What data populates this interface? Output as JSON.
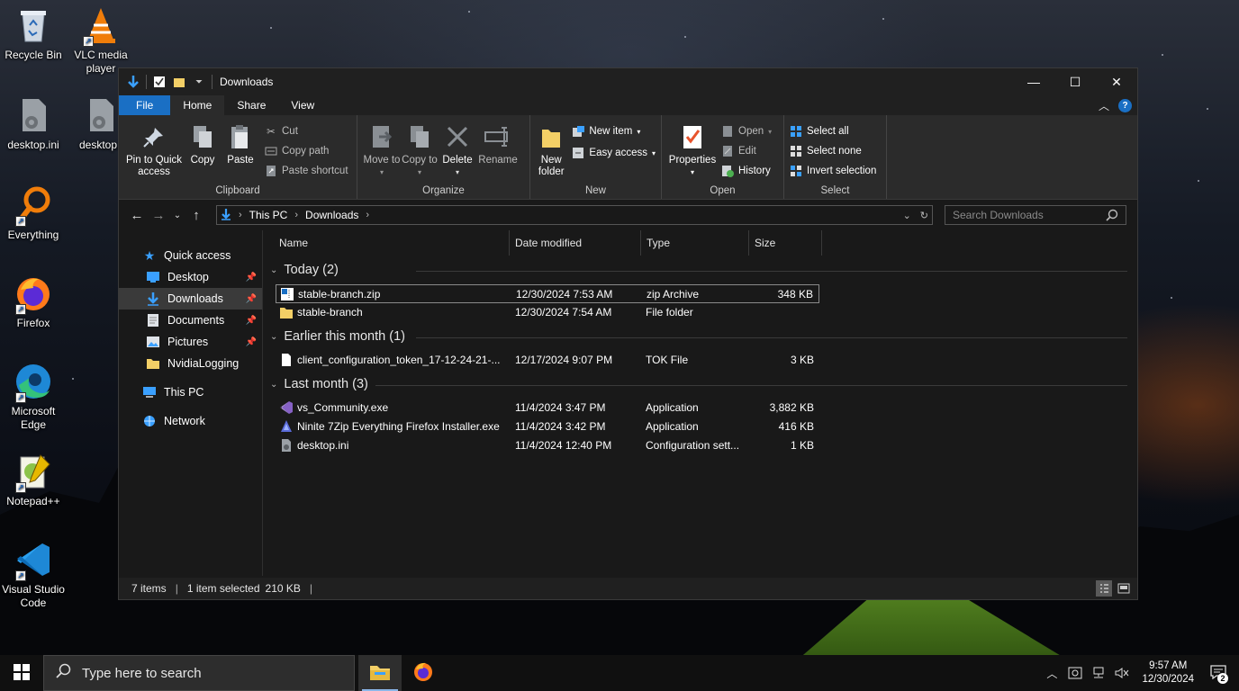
{
  "desktop": {
    "icons": [
      {
        "label": "Recycle Bin",
        "icon": "recycle-bin-icon"
      },
      {
        "label": "VLC media player",
        "icon": "vlc-icon"
      },
      {
        "label": "desktop.ini",
        "icon": "settings-file-icon"
      },
      {
        "label": "desktop.i",
        "icon": "settings-file-icon"
      },
      {
        "label": "Everything",
        "icon": "everything-search-icon"
      },
      {
        "label": "Firefox",
        "icon": "firefox-icon"
      },
      {
        "label": "Microsoft Edge",
        "icon": "edge-icon"
      },
      {
        "label": "Notepad++",
        "icon": "notepadpp-icon"
      },
      {
        "label": "Visual Studio Code",
        "icon": "vscode-icon"
      }
    ]
  },
  "window": {
    "title": "Downloads",
    "controls": {
      "minimize": "—",
      "maximize": "☐",
      "close": "✕"
    }
  },
  "ribbon_tabs": [
    "File",
    "Home",
    "Share",
    "View"
  ],
  "ribbon": {
    "clipboard": {
      "label": "Clipboard",
      "pin": "Pin to Quick access",
      "copy": "Copy",
      "paste": "Paste",
      "cut": "Cut",
      "copy_path": "Copy path",
      "paste_shortcut": "Paste shortcut"
    },
    "organize": {
      "label": "Organize",
      "move_to": "Move to",
      "copy_to": "Copy to",
      "delete": "Delete",
      "rename": "Rename"
    },
    "new": {
      "label": "New",
      "new_folder": "New folder",
      "new_item": "New item",
      "easy_access": "Easy access"
    },
    "open": {
      "label": "Open",
      "properties": "Properties",
      "open": "Open",
      "edit": "Edit",
      "history": "History"
    },
    "select": {
      "label": "Select",
      "select_all": "Select all",
      "select_none": "Select none",
      "invert": "Invert selection"
    }
  },
  "address": {
    "crumbs": [
      "This PC",
      "Downloads"
    ],
    "search_placeholder": "Search Downloads"
  },
  "nav": {
    "quick_access": "Quick access",
    "items": [
      {
        "label": "Desktop",
        "pinned": true
      },
      {
        "label": "Downloads",
        "pinned": true
      },
      {
        "label": "Documents",
        "pinned": true
      },
      {
        "label": "Pictures",
        "pinned": true
      },
      {
        "label": "NvidiaLogging",
        "pinned": false
      }
    ],
    "this_pc": "This PC",
    "network": "Network"
  },
  "columns": [
    "Name",
    "Date modified",
    "Type",
    "Size"
  ],
  "groups": [
    {
      "title": "Today (2)",
      "files": [
        {
          "name": "stable-branch.zip",
          "date": "12/30/2024 7:53 AM",
          "type": "zip Archive",
          "size": "348 KB",
          "icon": "zip-icon",
          "selected": true
        },
        {
          "name": "stable-branch",
          "date": "12/30/2024 7:54 AM",
          "type": "File folder",
          "size": "",
          "icon": "folder-icon",
          "selected": false
        }
      ]
    },
    {
      "title": "Earlier this month (1)",
      "files": [
        {
          "name": "client_configuration_token_17-12-24-21-...",
          "date": "12/17/2024 9:07 PM",
          "type": "TOK File",
          "size": "3 KB",
          "icon": "blank-file-icon",
          "selected": false
        }
      ]
    },
    {
      "title": "Last month (3)",
      "files": [
        {
          "name": "vs_Community.exe",
          "date": "11/4/2024 3:47 PM",
          "type": "Application",
          "size": "3,882 KB",
          "icon": "visual-studio-icon",
          "selected": false
        },
        {
          "name": "Ninite 7Zip Everything Firefox Installer.exe",
          "date": "11/4/2024 3:42 PM",
          "type": "Application",
          "size": "416 KB",
          "icon": "ninite-icon",
          "selected": false
        },
        {
          "name": "desktop.ini",
          "date": "11/4/2024 12:40 PM",
          "type": "Configuration sett...",
          "size": "1 KB",
          "icon": "settings-file-icon",
          "selected": false
        }
      ]
    }
  ],
  "status": {
    "items": "7 items",
    "selected": "1 item selected",
    "size": "210 KB"
  },
  "taskbar": {
    "search_placeholder": "Type here to search",
    "time": "9:57 AM",
    "date": "12/30/2024",
    "notifications": "2"
  }
}
